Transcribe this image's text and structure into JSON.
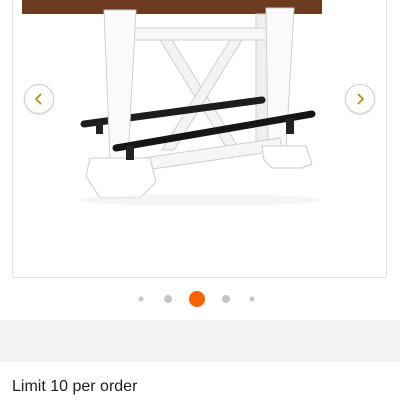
{
  "carousel": {
    "prev_icon": "chevron-left-icon",
    "next_icon": "chevron-right-icon",
    "accent_color": "#F96302",
    "dots": [
      {
        "state": "small"
      },
      {
        "state": "medium"
      },
      {
        "state": "active"
      },
      {
        "state": "medium"
      },
      {
        "state": "small"
      }
    ]
  },
  "product": {
    "order_limit": "Limit 10 per order"
  }
}
